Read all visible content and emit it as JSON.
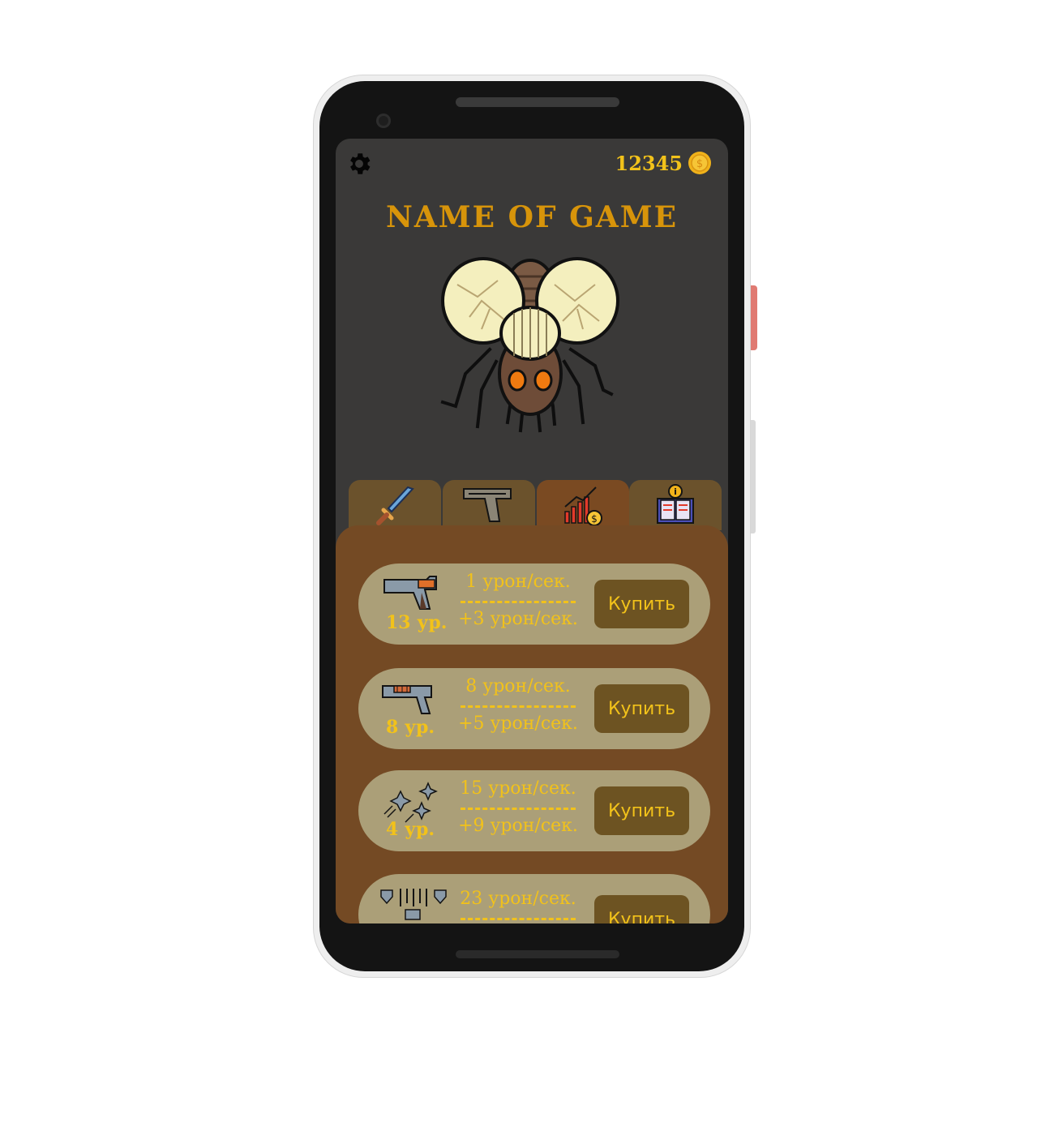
{
  "header": {
    "coins": "12345"
  },
  "game": {
    "title": "Name of Game"
  },
  "tabs": [
    {
      "icon": "sword-icon"
    },
    {
      "icon": "pistol-icon"
    },
    {
      "icon": "growth-chart-icon",
      "active": true
    },
    {
      "icon": "book-info-icon"
    }
  ],
  "shop": {
    "items": [
      {
        "icon": "desert-eagle-icon",
        "level": "13 ур.",
        "dps": "1 урон/сек.",
        "increment": "+3 урон/сек.",
        "buy_label": "Купить"
      },
      {
        "icon": "shotgun-pistol-icon",
        "level": "8 ур.",
        "dps": "8 урон/сек.",
        "increment": "+5 урон/сек.",
        "buy_label": "Купить"
      },
      {
        "icon": "shuriken-icon",
        "level": "4 ур.",
        "dps": "15 урон/сек.",
        "increment": "+9 урон/сек.",
        "buy_label": "Купить"
      },
      {
        "icon": "bullets-rain-icon",
        "level": "",
        "dps": "23 урон/сек.",
        "increment": "",
        "buy_label": "Купить"
      }
    ]
  },
  "colors": {
    "accent": "#f2c21a",
    "title": "#d7940a",
    "panel": "#744a24",
    "card": "#ab9f78",
    "button": "#6d5322",
    "screen": "#3a3938"
  }
}
